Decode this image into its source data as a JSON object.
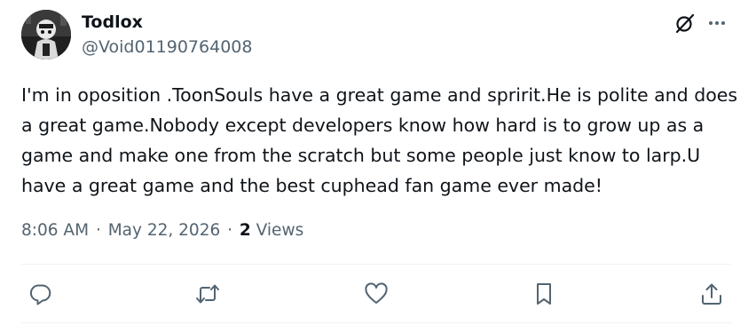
{
  "author": {
    "display_name": "Todlox",
    "handle": "@Void01190764008"
  },
  "post": {
    "text": "I'm in oposition .ToonSouls have a great game and spririt.He is polite and does a great game.Nobody except developers know how hard is to grow up as a game and make one from the scratch but some people just know to larp.U have a great game and the best cuphead fan game ever made!",
    "time": "8:06 AM",
    "separator": "·",
    "date": "May 22, 2026",
    "views_count": "2",
    "views_label": "Views"
  },
  "icons": {
    "header": [
      "grok-icon",
      "more-icon"
    ],
    "actions": [
      "reply-icon",
      "repost-icon",
      "like-icon",
      "bookmark-icon",
      "share-icon"
    ]
  },
  "colors": {
    "primary_text": "#0f1419",
    "secondary_text": "#536471",
    "divider": "#eff3f4",
    "background": "#ffffff"
  }
}
